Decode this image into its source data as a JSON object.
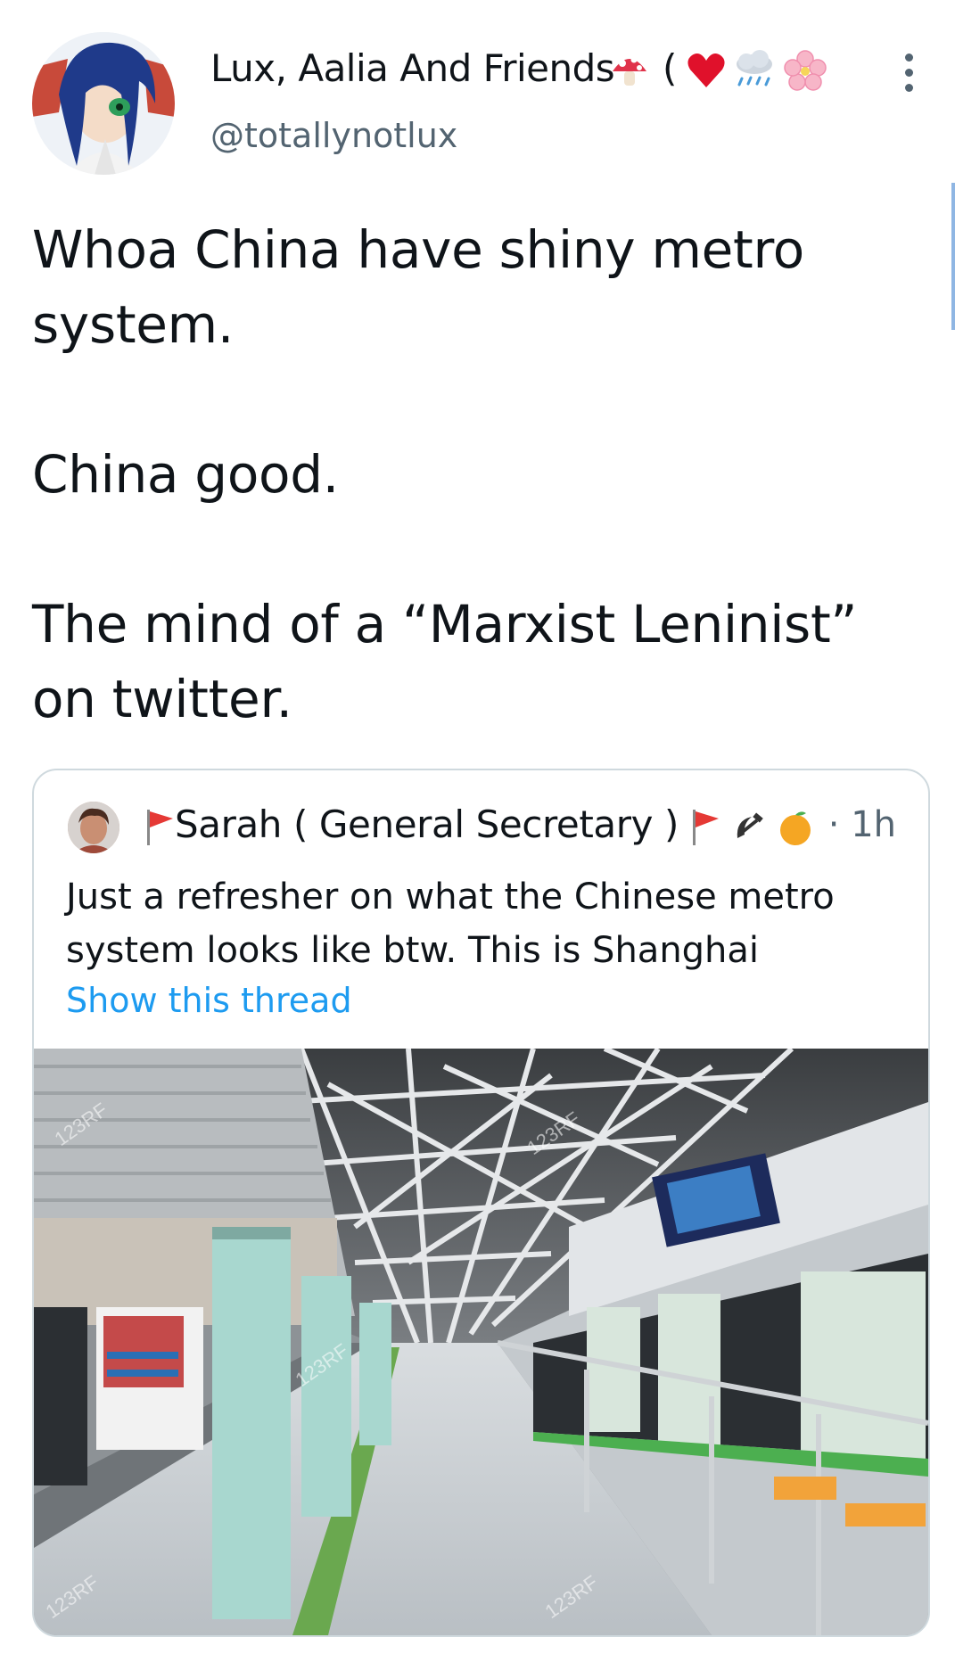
{
  "author": {
    "display_name": "Lux, Aalia And Friends",
    "name_suffix": "(",
    "handle": "@totallynotlux"
  },
  "tweet": {
    "paragraphs": [
      "Whoa China have shiny metro system.",
      "China good.",
      "The mind of a “Marxist Leninist” on twitter."
    ]
  },
  "quoted_tweet": {
    "display_name": "Sarah ( General Secretary )",
    "time": "· 1h",
    "text": "Just a refresher on what the Chinese metro system looks like btw. This is Shanghai",
    "show_thread_label": "Show this thread",
    "photo_watermark": "123RF"
  },
  "icons": {
    "name_emoji": [
      "mushroom-icon",
      "heart-icon",
      "rain-cloud-icon",
      "cherry-blossom-icon"
    ],
    "quoted_name_emoji": [
      "red-flag-icon",
      "red-flag-icon",
      "hammer-sickle-icon",
      "orange-icon"
    ],
    "more": "more-vertical-icon"
  },
  "colors": {
    "text_primary": "#0f1419",
    "text_secondary": "#536471",
    "link": "#1d9bf0",
    "border": "#cfd9de"
  }
}
